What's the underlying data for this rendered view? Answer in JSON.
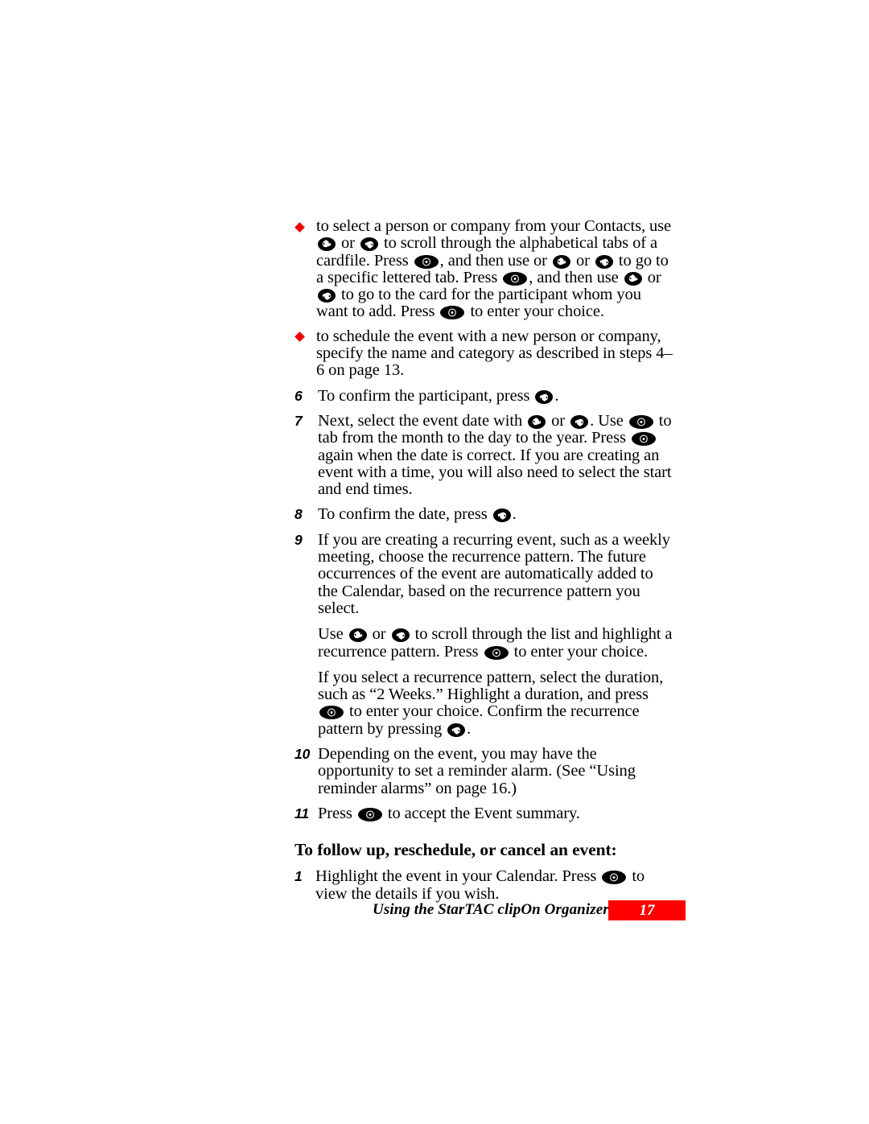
{
  "document": {
    "page_number": "17",
    "footer_title": "Using the StarTAC clipOn Organizer"
  },
  "icons": {
    "scroll_down": "scroll-down-key-icon",
    "scroll_up": "scroll-up-key-icon",
    "select": "select-enter-key-icon"
  },
  "body": {
    "bullet_1": {
      "t1": "to select a person or company from your Contacts, use",
      "t2": "or",
      "t3": "to scroll through the alphabetical tabs of a cardfile. Press",
      "t4": ", and then use",
      "t5": "or",
      "t6": "to go to a specific lettered tab. Press",
      "t7": ", and then use",
      "t8": "or",
      "t9": "to go to the card for the participant whom you want to add. Press",
      "t10": "to enter your choice."
    },
    "bullet_2": {
      "t1": "to schedule the event with a new person or company, specify the name and category as described in steps 4–6 on page 13."
    },
    "step_6": {
      "num": "6",
      "t1": "To confirm the participant, press",
      "t2": "."
    },
    "step_7": {
      "num": "7",
      "t1": "Next, select the event date with",
      "t2": "or",
      "t3": ". Use",
      "t4": "to tab from the month to the day to the year. Press",
      "t5": "again when the date is correct. If you are creating an event with a time, you will also need to select the start and end times."
    },
    "step_8": {
      "num": "8",
      "t1": "To confirm the date, press",
      "t2": "."
    },
    "step_9": {
      "num": "9",
      "t1": "If you are creating a recurring event, such as a weekly meeting, choose the recurrence pattern. The future occurrences of the event are automatically added to the Calendar, based on the recurrence pattern you select.",
      "t2": "Use",
      "t3": "or",
      "t4": "to scroll through the list and highlight a recurrence pattern. Press",
      "t5": "to enter your choice.",
      "t6": "If you select a recurrence pattern, select the duration, such as “2 Weeks.” Highlight a duration, and press",
      "t7": "to enter your choice. Confirm the recurrence pattern by pressing",
      "t8": "."
    },
    "step_10": {
      "num": "10",
      "t1": "Depending on the event, you may have the opportunity to set a reminder alarm. (See “Using reminder alarms” on page 16.)"
    },
    "step_11": {
      "num": "11",
      "t1": "Press",
      "t2": "to accept the Event summary."
    },
    "heading_follow_up": "To follow up, reschedule, or cancel an event:",
    "step_f1": {
      "num": "1",
      "t1": "Highlight the event in your Calendar. Press",
      "t2": "to view the details if you wish."
    }
  },
  "colors": {
    "bullet_diamond": "#ee0000",
    "page_box": "#ff0000",
    "text": "#000000"
  }
}
